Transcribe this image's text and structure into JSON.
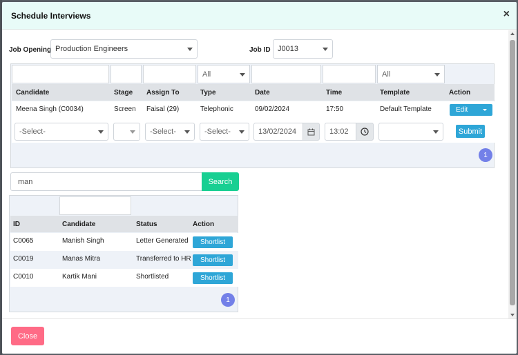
{
  "dialog": {
    "title": "Schedule Interviews",
    "close_glyph": "×"
  },
  "form": {
    "job_opening_label": "Job Opening",
    "job_opening_value": "Production Engineers",
    "job_id_label": "Job ID",
    "job_id_value": "J0013"
  },
  "interview_table": {
    "filters": {
      "type": "All",
      "template": "All"
    },
    "columns": [
      "Candidate",
      "Stage",
      "Assign To",
      "Type",
      "Date",
      "Time",
      "Template",
      "Action"
    ],
    "rows": [
      {
        "candidate": "Meena Singh (C0034)",
        "stage": "Screen",
        "assign_to": "Faisal (29)",
        "type": "Telephonic",
        "date": "09/02/2024",
        "time": "17:50",
        "template": "Default Template",
        "action": "Edit"
      }
    ],
    "new_row": {
      "candidate_placeholder": "-Select-",
      "assign_placeholder": "-Select-",
      "type_placeholder": "-Select-",
      "date": "13/02/2024",
      "time": "13:02",
      "submit": "Submit"
    },
    "page": "1"
  },
  "search": {
    "value": "man",
    "button": "Search"
  },
  "candidate_table": {
    "columns": [
      "ID",
      "Candidate",
      "Status",
      "Action"
    ],
    "rows": [
      {
        "id": "C0065",
        "candidate": "Manish Singh",
        "status": "Letter Generated",
        "action": "Shortlist"
      },
      {
        "id": "C0019",
        "candidate": "Manas Mitra",
        "status": "Transferred to HR",
        "action": "Shortlist"
      },
      {
        "id": "C0010",
        "candidate": "Kartik Mani",
        "status": "Shortlisted",
        "action": "Shortlist"
      }
    ],
    "page": "1"
  },
  "footer": {
    "close": "Close"
  },
  "colors": {
    "header_bg": "#e8fbf8",
    "info": "#2ea6d7",
    "success": "#18cf92",
    "danger": "#ff6b86",
    "pagination": "#7380e8"
  }
}
